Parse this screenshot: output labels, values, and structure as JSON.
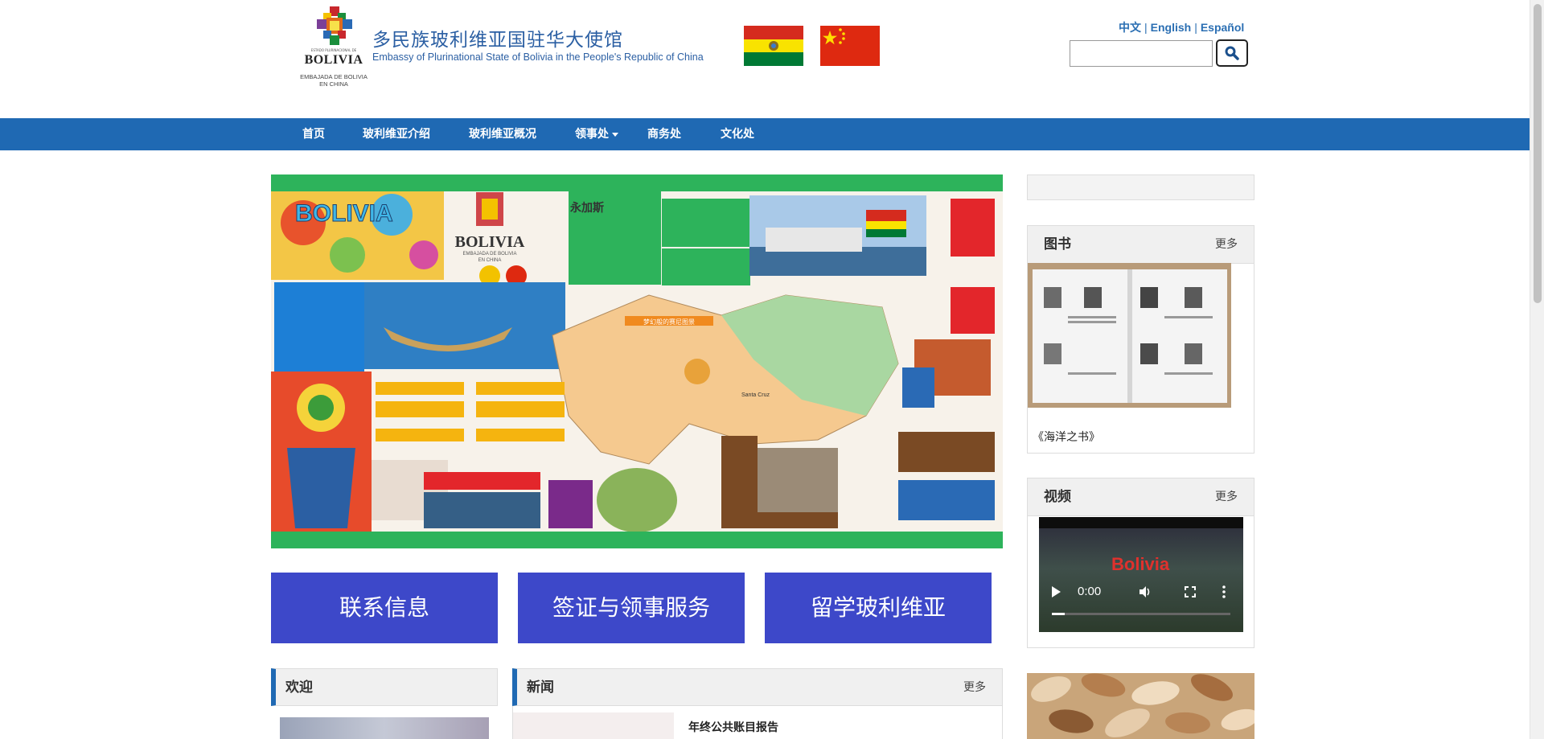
{
  "header": {
    "logo": {
      "estado": "ESTADO PLURINACIONAL DE",
      "name": "BOLIVIA",
      "embajada_line1": "EMBAJADA DE BOLIVIA",
      "embajada_line2": "EN CHINA"
    },
    "title_cn": "多民族玻利维亚国驻华大使馆",
    "title_en": "Embassy of Plurinational State of Bolivia in the People's Republic of China",
    "languages": [
      "中文",
      "English",
      "Español"
    ],
    "separator": "|",
    "search": {
      "placeholder": ""
    }
  },
  "nav": {
    "items": [
      "首页",
      "玻利维亚介绍",
      "玻利维亚概况",
      "领事处",
      "商务处",
      "文化处"
    ]
  },
  "banner": {
    "doodle_word": "BOLIVIA",
    "logo_name": "BOLIVIA",
    "logo_sub": "EMBAJADA DE BOLIVIA",
    "logo_sub2": "EN CHINA",
    "headline": "永加斯",
    "map_label": "梦幻般的赛尼图景",
    "map_city": "Santa Cruz"
  },
  "services": [
    "联系信息",
    "签证与领事服务",
    "留学玻利维亚"
  ],
  "panels": {
    "welcome": {
      "title": "欢迎"
    },
    "news": {
      "title": "新闻",
      "more": "更多",
      "first_item": "年终公共账目报告"
    }
  },
  "sidebar": {
    "books": {
      "title": "图书",
      "more": "更多",
      "caption": "《海洋之书》"
    },
    "video": {
      "title": "视频",
      "more": "更多",
      "time": "0:00",
      "overlay_text": "Bolivia"
    }
  },
  "colors": {
    "nav": "#1f69b3",
    "service_button": "#3d48c9",
    "banner_bar": "#2db35b",
    "title_text": "#2b5fa3"
  }
}
